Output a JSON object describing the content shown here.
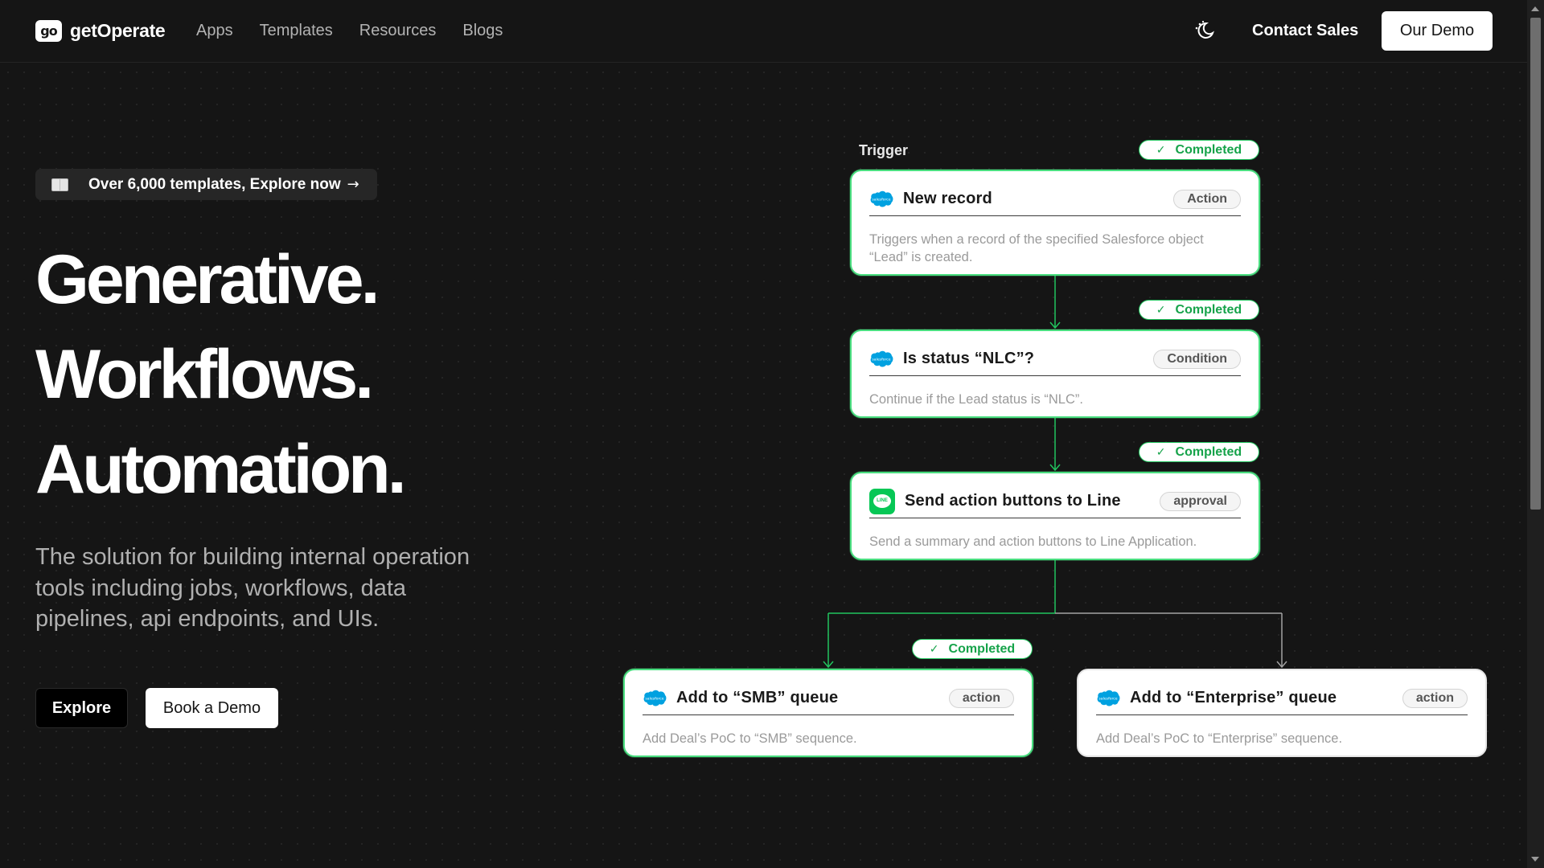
{
  "nav": {
    "logo_mark": "go",
    "logo_text": "getOperate",
    "links": [
      "Apps",
      "Templates",
      "Resources",
      "Blogs"
    ],
    "theme_icon": "moon-sun-toggle-icon",
    "contact_label": "Contact Sales",
    "demo_label": "Our Demo"
  },
  "hero": {
    "pill_text": "Over 6,000 templates, Explore now",
    "pill_arrow": "→",
    "headline": [
      "Generative.",
      "Workflows.",
      "Automation."
    ],
    "subtitle": "The solution for building internal operation tools including jobs, workflows, data pipelines, api endpoints, and UIs.",
    "explore_label": "Explore",
    "book_label": "Book a Demo"
  },
  "flow": {
    "trigger_label": "Trigger",
    "status_label": "Completed",
    "status_color": "#22c55e",
    "nodes": [
      {
        "icon": "salesforce-icon",
        "title": "New record",
        "type": "Action",
        "desc": "Triggers when a record of the specified Salesforce object “Lead” is created."
      },
      {
        "icon": "salesforce-icon",
        "title": "Is status “NLC”?",
        "type": "Condition",
        "desc": "Continue if the Lead status is “NLC”."
      },
      {
        "icon": "line-app-icon",
        "title": "Send action buttons to Line",
        "type": "approval",
        "desc": "Send a summary and action buttons to Line Application."
      },
      {
        "icon": "salesforce-icon",
        "title": "Add to “SMB” queue",
        "type": "action",
        "desc": "Add Deal’s PoC to “SMB” sequence."
      },
      {
        "icon": "salesforce-icon",
        "title": "Add to “Enterprise” queue",
        "type": "action",
        "desc": "Add Deal’s PoC to “Enterprise” sequence."
      }
    ],
    "line_app_text": "LINE",
    "salesforce_text": "salesforce"
  }
}
